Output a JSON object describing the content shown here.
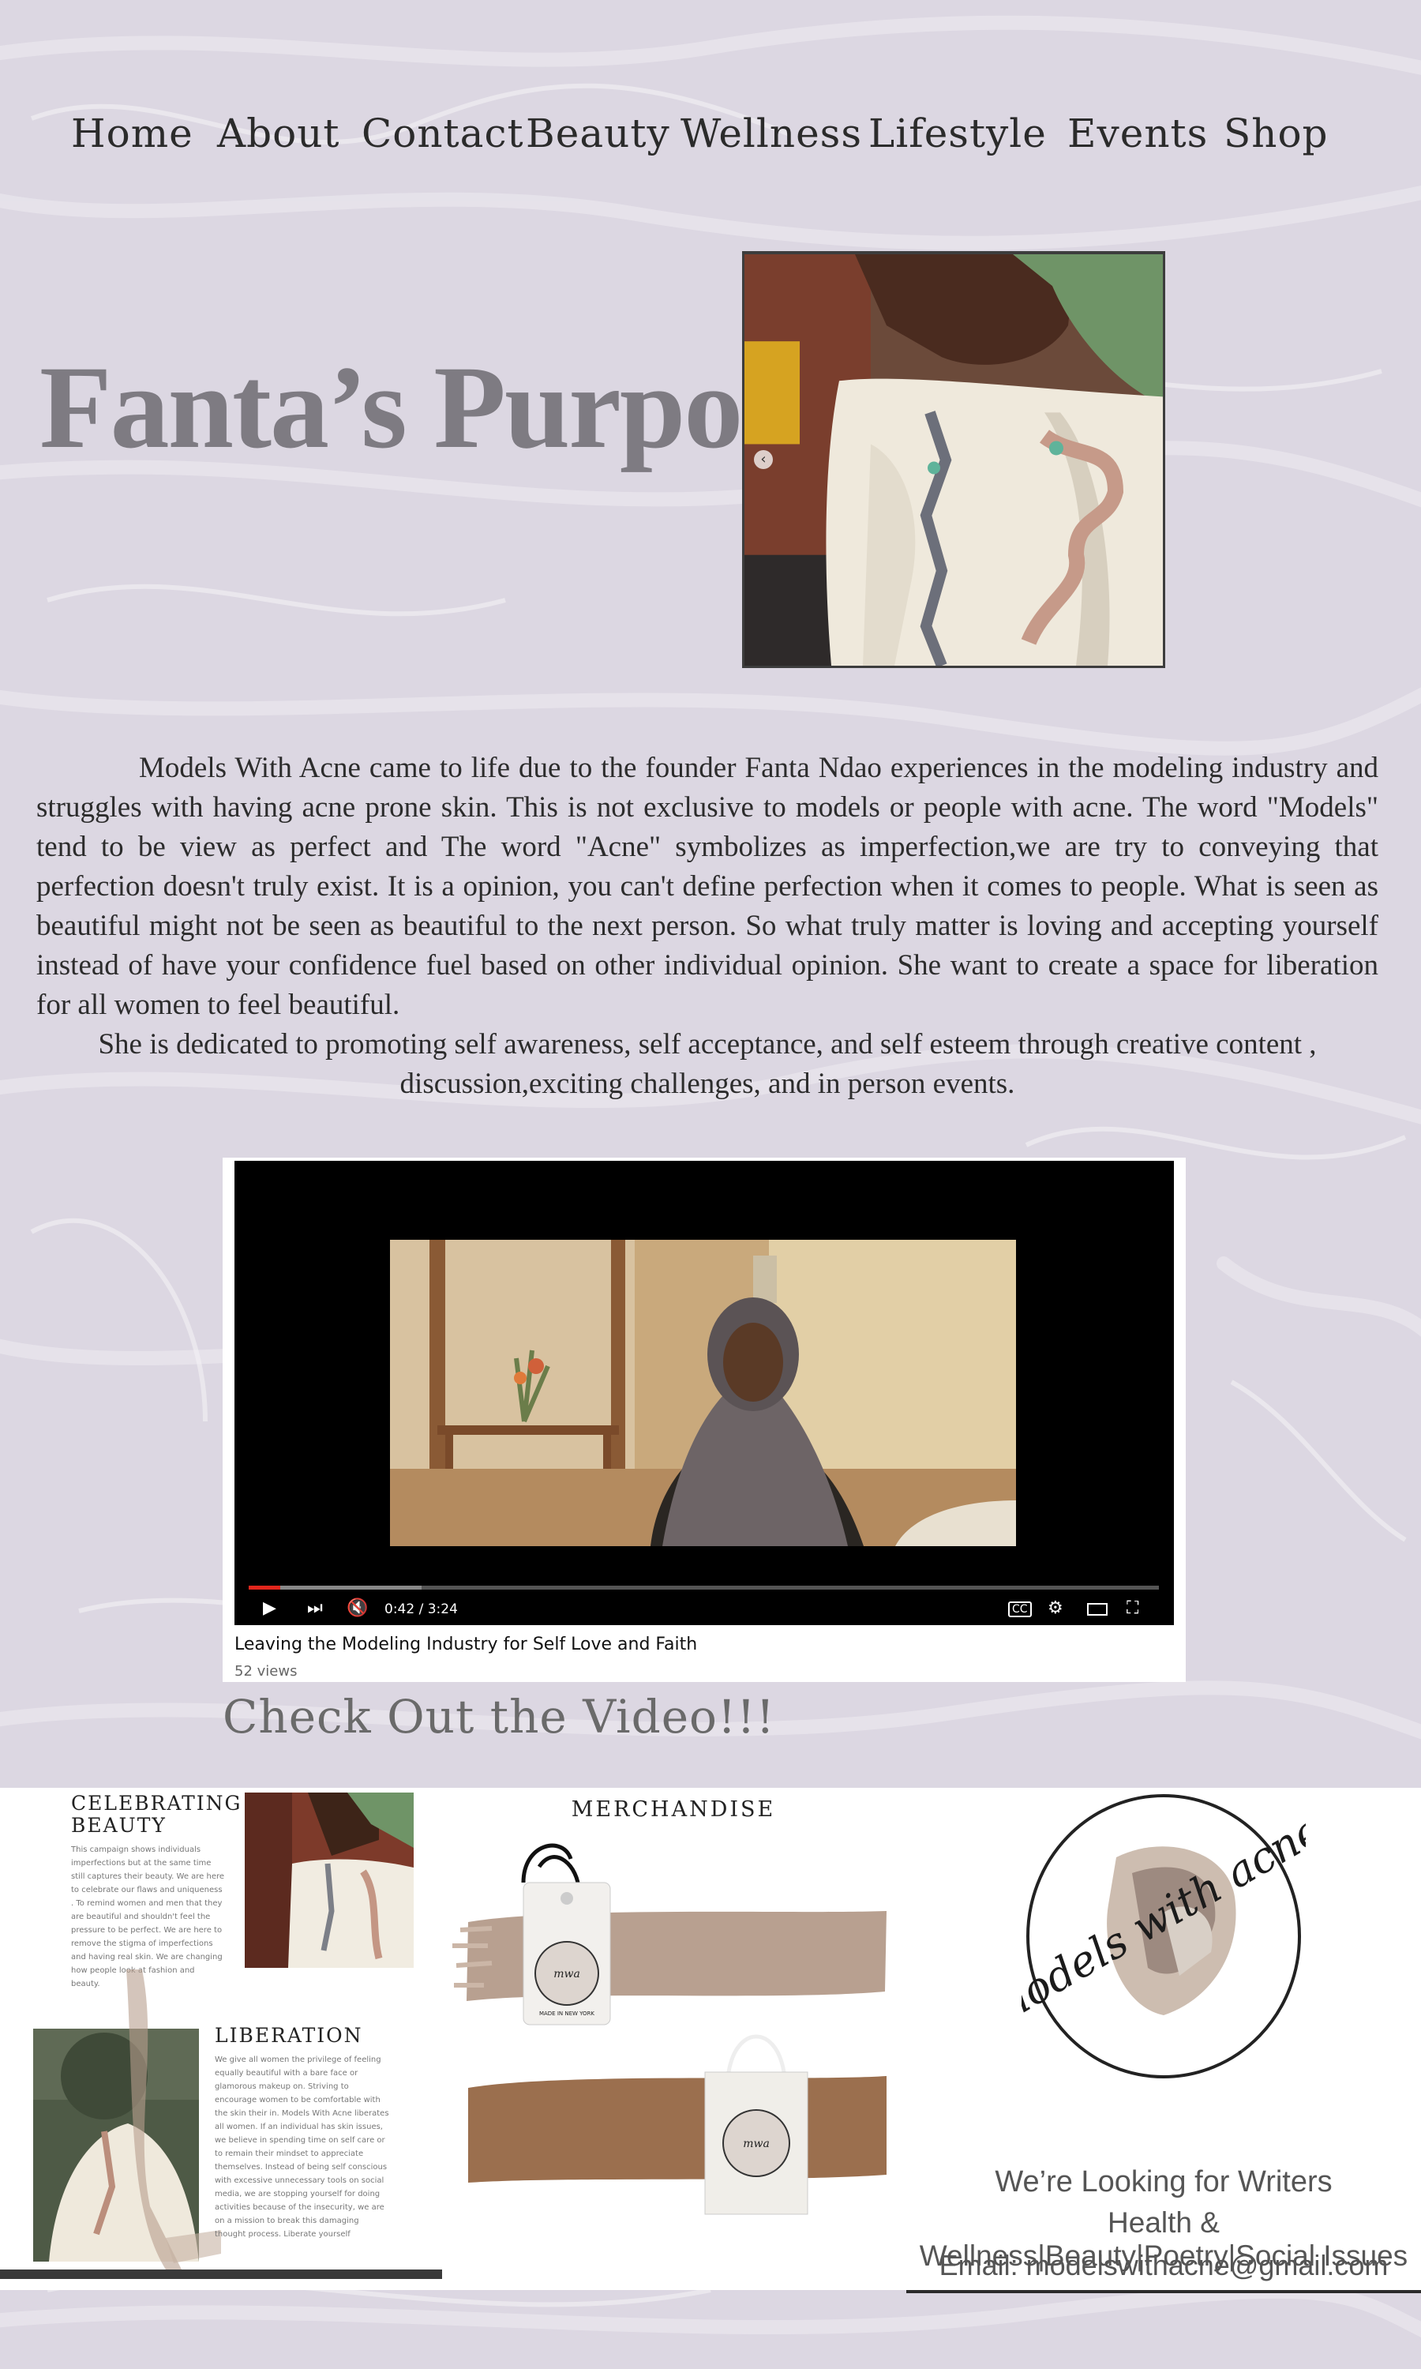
{
  "nav": {
    "items": [
      "Home",
      "About",
      "Contact",
      "Beauty",
      "Wellness",
      "Lifestyle",
      "Events",
      "Shop"
    ]
  },
  "hero": {
    "title": "Fanta’s Purpose"
  },
  "about": {
    "paragraph1": "Models With Acne came to life due to the founder Fanta Ndao experiences in the modeling industry and struggles with having acne prone skin. This is not exclusive to models or people with acne. The word \"Models\" tend to be view as perfect and The word \"Acne\" symbolizes as imperfection,we are try to conveying that perfection doesn't truly exist. It is a opinion, you can't define perfection when it comes to people. What is seen as beautiful might not be seen as beautiful to the next person. So what truly matter is loving and accepting yourself instead of have your confidence fuel based on other individual opinion. She want to create a space for liberation for all women to feel beautiful.",
    "paragraph2": "She is dedicated to promoting self awareness, self acceptance, and self esteem through creative content , discussion,exciting challenges, and in person events."
  },
  "video": {
    "title": "Leaving the Modeling Industry for Self Love and Faith",
    "views": "52 views",
    "time": "0:42 / 3:24",
    "played_fraction": 0.035,
    "buffered_fraction": 0.19
  },
  "check_video": "Check Out the Video!!!",
  "panels": {
    "celebrate": {
      "heading1": "CELEBRATING",
      "heading2": "BEAUTY",
      "body1": "This campaign shows individuals imperfections but at the same time still captures their beauty. We are here to celebrate our flaws and uniqueness . To remind women and men that they are beautiful and shouldn't feel the pressure to be perfect. We are here to remove the stigma of imperfections and having real skin. We are changing how people look at fashion and beauty.",
      "heading3": "LIBERATION",
      "body2": "We give all women the privilege of feeling equally beautiful with a bare face or glamorous makeup on. Striving to encourage women to be comfortable with the skin their in. Models With Acne liberates all women. If an individual has skin issues, we believe in spending time on self care or to remain their mindset to appreciate themselves. Instead of being self conscious with excessive unnecessary tools on social media, we are stopping yourself for doing activities because of the insecurity, we are on a mission to break this damaging thought process. Liberate yourself"
    },
    "merch": {
      "title": "MERCHANDISE",
      "tag_label": "MADE IN NEW YORK"
    },
    "writers": {
      "logo_text": "models with acne",
      "line1": "We’re Looking for Writers",
      "line2": "Health & Wellness|Beauty|Poetry|Social Issues",
      "line3": "Email: modelswithacne@gmail.com"
    }
  }
}
